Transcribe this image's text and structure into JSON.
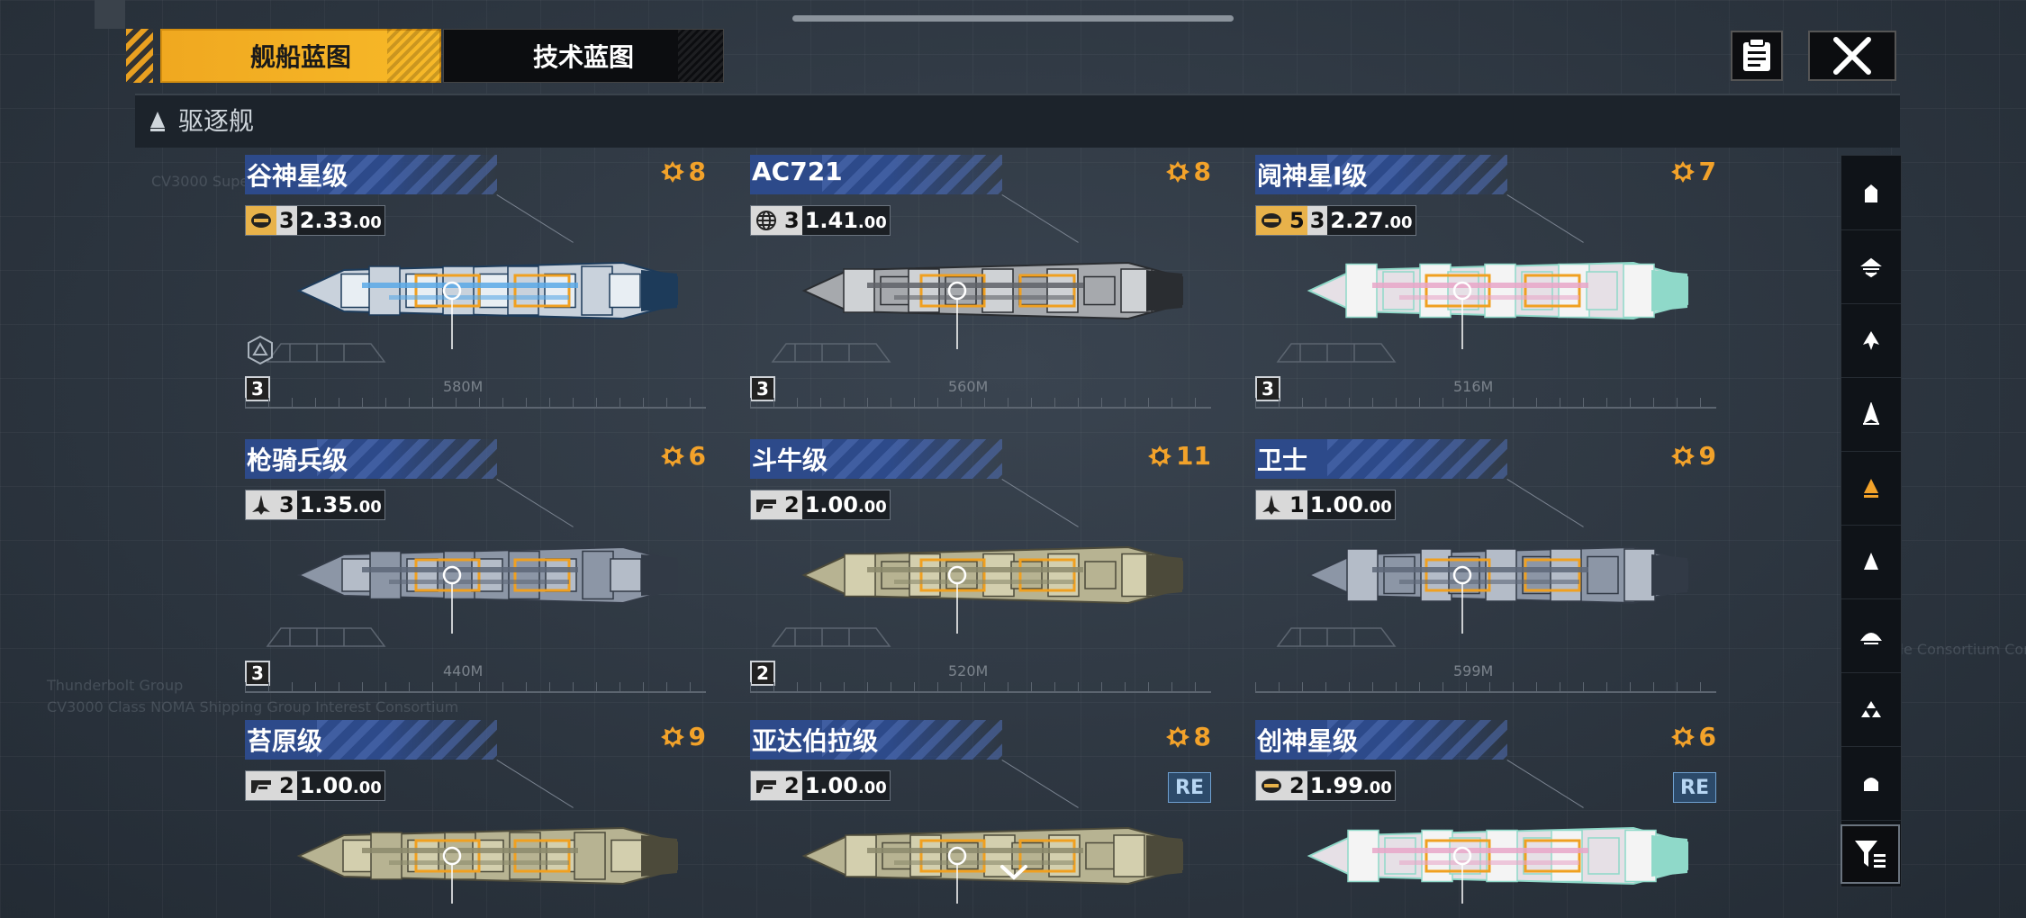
{
  "tabs": [
    {
      "label": "舰船蓝图",
      "active": true
    },
    {
      "label": "技术蓝图",
      "active": false
    }
  ],
  "section": {
    "title": "驱逐舰"
  },
  "colors": {
    "accent": "#f2a22a",
    "namebar": "#2d4a8a",
    "re_badge": "#2c4a6a"
  },
  "cards": [
    {
      "name": "谷神星级",
      "cost": "8",
      "type_icon": "carrier-shield-icon",
      "type_highlight": true,
      "extra": "",
      "tier": "3",
      "ratio": "2.33",
      "level": "3",
      "length": "580M",
      "re": "",
      "ship_palette": "blue"
    },
    {
      "name": "AC721",
      "cost": "8",
      "type_icon": "globe-icon",
      "type_highlight": false,
      "extra": "",
      "tier": "3",
      "ratio": "1.41",
      "level": "3",
      "length": "560M",
      "re": "",
      "ship_palette": "grey"
    },
    {
      "name": "阋神星I级",
      "cost": "7",
      "type_icon": "carrier-shield-icon",
      "type_highlight": true,
      "extra": "5",
      "tier": "3",
      "ratio": "2.27",
      "level": "3",
      "length": "516M",
      "re": "",
      "ship_palette": "pastel"
    },
    {
      "name": "枪骑兵级",
      "cost": "6",
      "type_icon": "fighter-icon",
      "type_highlight": false,
      "extra": "",
      "tier": "3",
      "ratio": "1.35",
      "level": "3",
      "length": "440M",
      "re": "",
      "ship_palette": "slate"
    },
    {
      "name": "斗牛级",
      "cost": "11",
      "type_icon": "cannon-icon",
      "type_highlight": false,
      "extra": "",
      "tier": "2",
      "ratio": "1.00",
      "level": "2",
      "length": "520M",
      "re": "",
      "ship_palette": "khaki"
    },
    {
      "name": "卫士",
      "cost": "9",
      "type_icon": "fighter-icon",
      "type_highlight": false,
      "extra": "",
      "tier": "1",
      "ratio": "1.00",
      "level": "",
      "length": "599M",
      "re": "",
      "ship_palette": "slate"
    },
    {
      "name": "苔原级",
      "cost": "9",
      "type_icon": "cannon-icon",
      "type_highlight": false,
      "extra": "",
      "tier": "2",
      "ratio": "1.00",
      "level": "",
      "length": "",
      "re": "",
      "ship_palette": "khaki"
    },
    {
      "name": "亚达伯拉级",
      "cost": "8",
      "type_icon": "cannon-icon",
      "type_highlight": false,
      "extra": "",
      "tier": "2",
      "ratio": "1.00",
      "level": "",
      "length": "",
      "re": "RE",
      "ship_palette": "khaki"
    },
    {
      "name": "创神星级",
      "cost": "6",
      "type_icon": "carrier-shield-icon",
      "type_highlight": false,
      "extra": "",
      "tier": "2",
      "ratio": "1.99",
      "level": "",
      "length": "",
      "re": "RE",
      "ship_palette": "pastel"
    }
  ],
  "ratio_suffix": ".00",
  "filter_rail": [
    {
      "icon": "frigate-filter-icon",
      "selected": false
    },
    {
      "icon": "corvette-filter-icon",
      "selected": false
    },
    {
      "icon": "destroyer-alt-filter-icon",
      "selected": false
    },
    {
      "icon": "cruiser-filter-icon",
      "selected": false
    },
    {
      "icon": "destroyer-filter-icon",
      "selected": true
    },
    {
      "icon": "battlecruiser-filter-icon",
      "selected": false
    },
    {
      "icon": "auxiliary-filter-icon",
      "selected": false
    },
    {
      "icon": "carrier-filter-icon",
      "selected": false
    },
    {
      "icon": "battleship-filter-icon",
      "selected": false
    }
  ]
}
